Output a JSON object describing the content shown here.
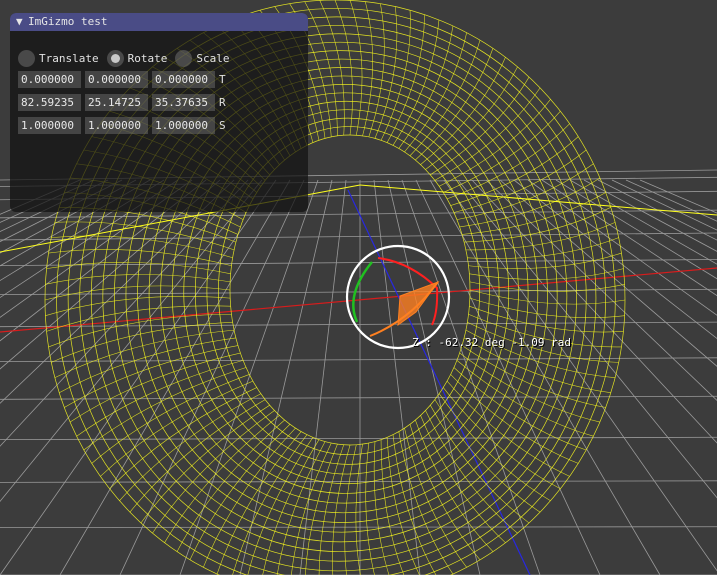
{
  "window": {
    "title": "ImGizmo test",
    "collapse_glyph": "▼"
  },
  "operations": [
    {
      "label": "Translate",
      "selected": false
    },
    {
      "label": "Rotate",
      "selected": true
    },
    {
      "label": "Scale",
      "selected": false
    }
  ],
  "transform": {
    "translation": {
      "label": "T",
      "values": [
        "0.000000",
        "0.000000",
        "0.000000"
      ]
    },
    "rotation": {
      "label": "R",
      "values": [
        "82.59235",
        "25.14725",
        "35.37635"
      ]
    },
    "scale": {
      "label": "S",
      "values": [
        "1.000000",
        "1.000000",
        "1.000000"
      ]
    }
  },
  "gizmo": {
    "readout": "Z : -62.32 deg -1.09 rad"
  },
  "colors": {
    "mesh": "#ffff1e",
    "axis_x": "#ff2020",
    "axis_y": "#20c020",
    "axis_z": "#3030ff",
    "rotation_fill": "#ff8020",
    "titlebar": "#4a4c86"
  }
}
